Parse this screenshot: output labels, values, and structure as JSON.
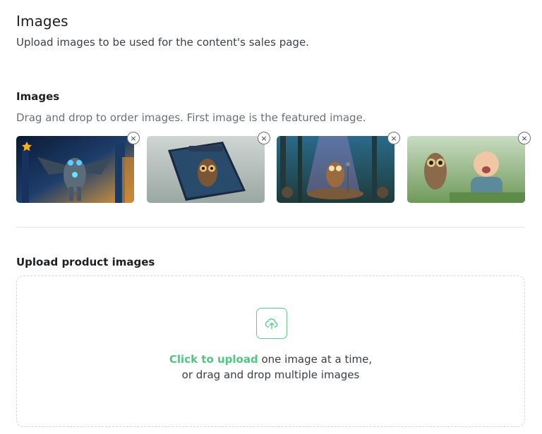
{
  "header": {
    "title": "Images",
    "description": "Upload images to be used for the content's sales page."
  },
  "images_section": {
    "title": "Images",
    "hint": "Drag and drop to order images. First image is the featured image.",
    "remove_label": "×",
    "items": [
      {
        "name": "robot-owl",
        "featured": true
      },
      {
        "name": "owl-keeping-book",
        "featured": false
      },
      {
        "name": "owl-on-stage",
        "featured": false
      },
      {
        "name": "owl-and-baby",
        "featured": false
      }
    ]
  },
  "upload_section": {
    "title": "Upload product images",
    "click_label": "Click to upload",
    "line1_rest": " one image at a time,",
    "line2": "or drag and drop multiple images"
  },
  "colors": {
    "accent": "#4dc781",
    "star": "#f5b21b"
  },
  "icons": [
    "star-icon",
    "close-icon",
    "upload-cloud-icon"
  ]
}
